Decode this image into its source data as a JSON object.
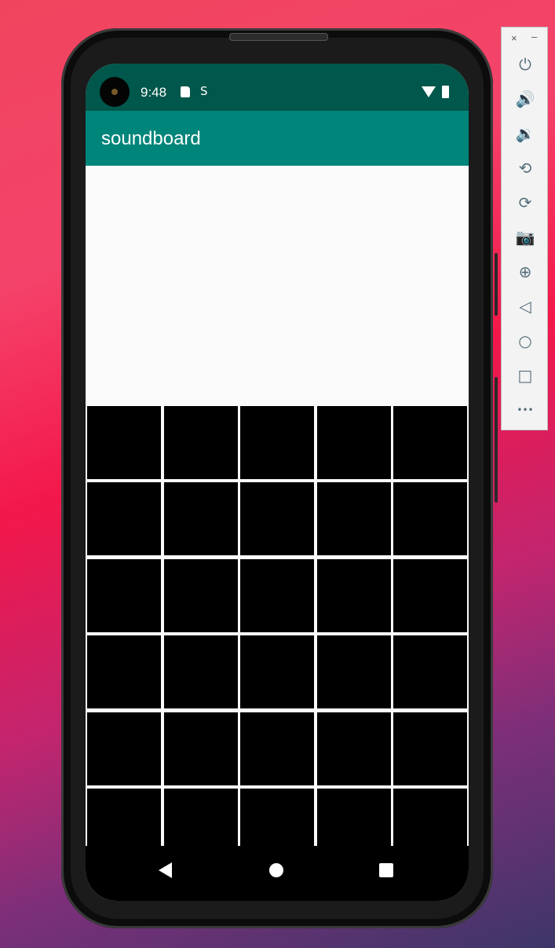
{
  "status_bar": {
    "time": "9:48",
    "s_icon": "S"
  },
  "app": {
    "title": "soundboard"
  },
  "grid": {
    "rows": 6,
    "columns": 5,
    "pad_color": "#000000"
  },
  "emulator_toolbar": {
    "close": "×",
    "minimize": "–",
    "buttons": [
      {
        "name": "power-icon",
        "glyph": "⏻"
      },
      {
        "name": "volume-up-icon",
        "glyph": "🔊"
      },
      {
        "name": "volume-down-icon",
        "glyph": "🔉"
      },
      {
        "name": "rotate-left-icon",
        "glyph": "⟲"
      },
      {
        "name": "rotate-right-icon",
        "glyph": "⟳"
      },
      {
        "name": "camera-icon",
        "glyph": "📷"
      },
      {
        "name": "zoom-icon",
        "glyph": "⊕"
      },
      {
        "name": "back-icon",
        "glyph": "◁"
      },
      {
        "name": "home-icon",
        "glyph": "○"
      },
      {
        "name": "overview-icon",
        "glyph": "□"
      },
      {
        "name": "more-icon",
        "glyph": "•••"
      }
    ]
  },
  "colors": {
    "status_bar": "#00574b",
    "toolbar": "#00857a",
    "background": "#fafafa"
  }
}
